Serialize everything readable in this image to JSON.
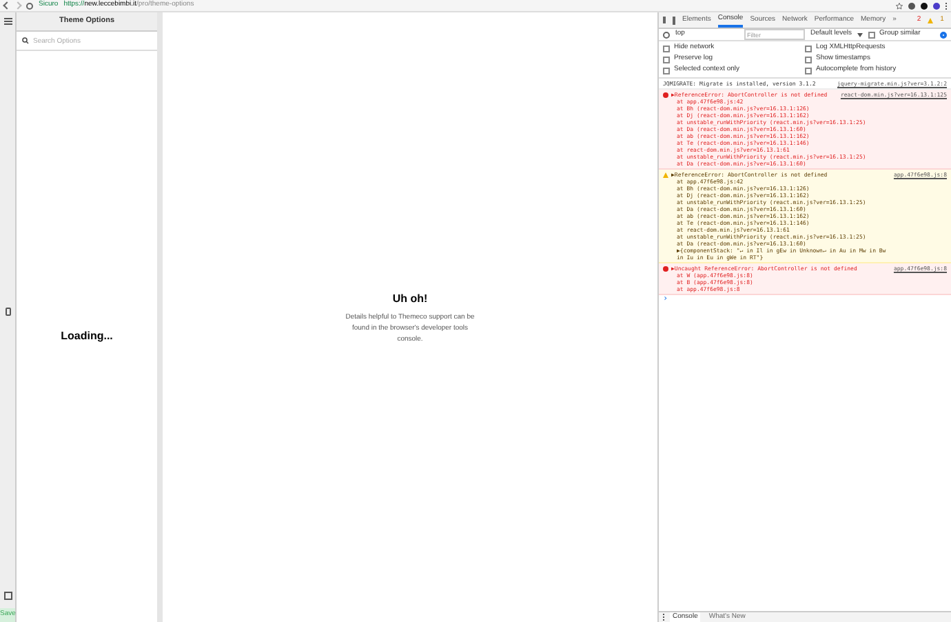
{
  "browser": {
    "secure_label": "Sicuro",
    "url_host": "https://new.leccebimbi.it",
    "url_path": "/pro/theme-options"
  },
  "app": {
    "panel_title": "Theme Options",
    "search": {
      "placeholder": "Search Options"
    },
    "loading": "Loading...",
    "save": "Save",
    "error_title": "Uh oh!",
    "error_text": "Details helpful to Themeco support can be found in the browser's developer tools console."
  },
  "devtools": {
    "tabs": [
      {
        "label": "Elements",
        "selected": false
      },
      {
        "label": "Console",
        "selected": true
      },
      {
        "label": "Sources",
        "selected": false
      },
      {
        "label": "Network",
        "selected": false
      },
      {
        "label": "Performance",
        "selected": false
      },
      {
        "label": "Memory",
        "selected": false
      }
    ],
    "more_tabs": "»",
    "error_count": "2",
    "warning_count": "1",
    "context": "top",
    "filter": {
      "placeholder": "Filter"
    },
    "levels": "Default levels",
    "group_similar": {
      "label": "Group similar",
      "checked": false
    },
    "options": [
      {
        "label": "Hide network",
        "checked": false
      },
      {
        "label": "Log XMLHttpRequests",
        "checked": false
      },
      {
        "label": "Preserve log",
        "checked": false
      },
      {
        "label": "Show timestamps",
        "checked": false
      },
      {
        "label": "Selected context only",
        "checked": false
      },
      {
        "label": "Autocomplete from history",
        "checked": false
      }
    ],
    "messages": [
      {
        "kind": "info",
        "text": "JQMIGRATE: Migrate is installed, version 3.1.2",
        "source": "jquery-migrate.min.js?ver=3.1.2:2"
      },
      {
        "kind": "error",
        "text": "▶ReferenceError: AbortController is not defined",
        "source": "react-dom.min.js?ver=16.13.1:125",
        "frames": [
          "at app.47f6e98.js:42",
          "at Bh (react-dom.min.js?ver=16.13.1:126)",
          "at Dj (react-dom.min.js?ver=16.13.1:162)",
          "at unstable_runWithPriority (react.min.js?ver=16.13.1:25)",
          "at Da (react-dom.min.js?ver=16.13.1:60)",
          "at ab (react-dom.min.js?ver=16.13.1:162)",
          "at Te (react-dom.min.js?ver=16.13.1:146)",
          "at react-dom.min.js?ver=16.13.1:61",
          "at unstable_runWithPriority (react.min.js?ver=16.13.1:25)",
          "at Da (react-dom.min.js?ver=16.13.1:60)"
        ]
      },
      {
        "kind": "warning",
        "text": "▶ReferenceError: AbortController is not defined",
        "source": "app.47f6e98.js:8",
        "frames": [
          "at app.47f6e98.js:42",
          "at Bh (react-dom.min.js?ver=16.13.1:126)",
          "at Dj (react-dom.min.js?ver=16.13.1:162)",
          "at unstable_runWithPriority (react.min.js?ver=16.13.1:25)",
          "at Da (react-dom.min.js?ver=16.13.1:60)",
          "at ab (react-dom.min.js?ver=16.13.1:162)",
          "at Te (react-dom.min.js?ver=16.13.1:146)",
          "at react-dom.min.js?ver=16.13.1:61",
          "at unstable_runWithPriority (react.min.js?ver=16.13.1:25)",
          "at Da (react-dom.min.js?ver=16.13.1:60)",
          "▶{componentStack: \"↵    in Il    in gEw    in Unknown↵    in Au    in Mw    in Bw",
          "in Iu    in Eu    in gWe    in RT\"}"
        ]
      },
      {
        "kind": "error",
        "text": "▶Uncaught ReferenceError: AbortController is not defined",
        "source": "app.47f6e98.js:8",
        "frames": [
          "at W (app.47f6e98.js:8)",
          "at B (app.47f6e98.js:8)",
          "at app.47f6e98.js:8"
        ]
      }
    ],
    "prompt": "›",
    "drawer_tabs": [
      {
        "label": "Console",
        "selected": true
      },
      {
        "label": "What's New",
        "selected": false
      }
    ]
  }
}
